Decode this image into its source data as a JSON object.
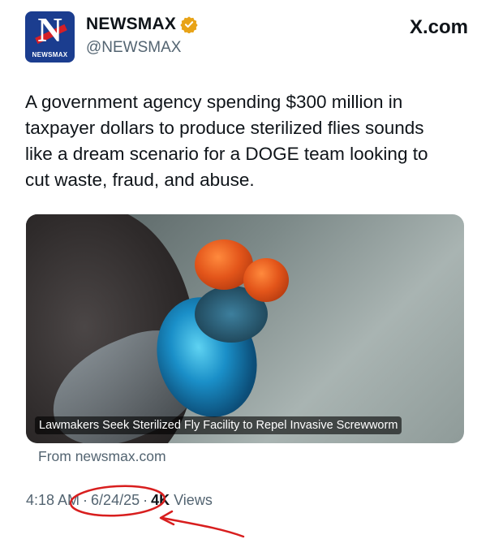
{
  "account": {
    "avatar_letter": "N",
    "avatar_brand": "NEWSMAX",
    "display_name": "NEWSMAX",
    "handle": "@NEWSMAX",
    "verified_icon": "gold-verified-badge-icon",
    "verified_color": "#e8a317"
  },
  "source_label": "X.com",
  "tweet": {
    "text": "A government agency spending $300 million in taxpayer dollars to produce sterilized flies sounds like a dream scenario for a DOGE team looking to cut waste, fraud, and abuse."
  },
  "link_card": {
    "image_icon": "fly-photo",
    "caption": "Lawmakers Seek Sterilized Fly Facility to Repel Invasive Screwworm",
    "from": "From newsmax.com"
  },
  "meta": {
    "time": "4:18 AM",
    "separator": "·",
    "date": "6/24/25",
    "views_count": "4K",
    "views_label": "Views"
  },
  "annotation": {
    "color": "#d81e1e",
    "shape": "circle-and-arrow"
  }
}
